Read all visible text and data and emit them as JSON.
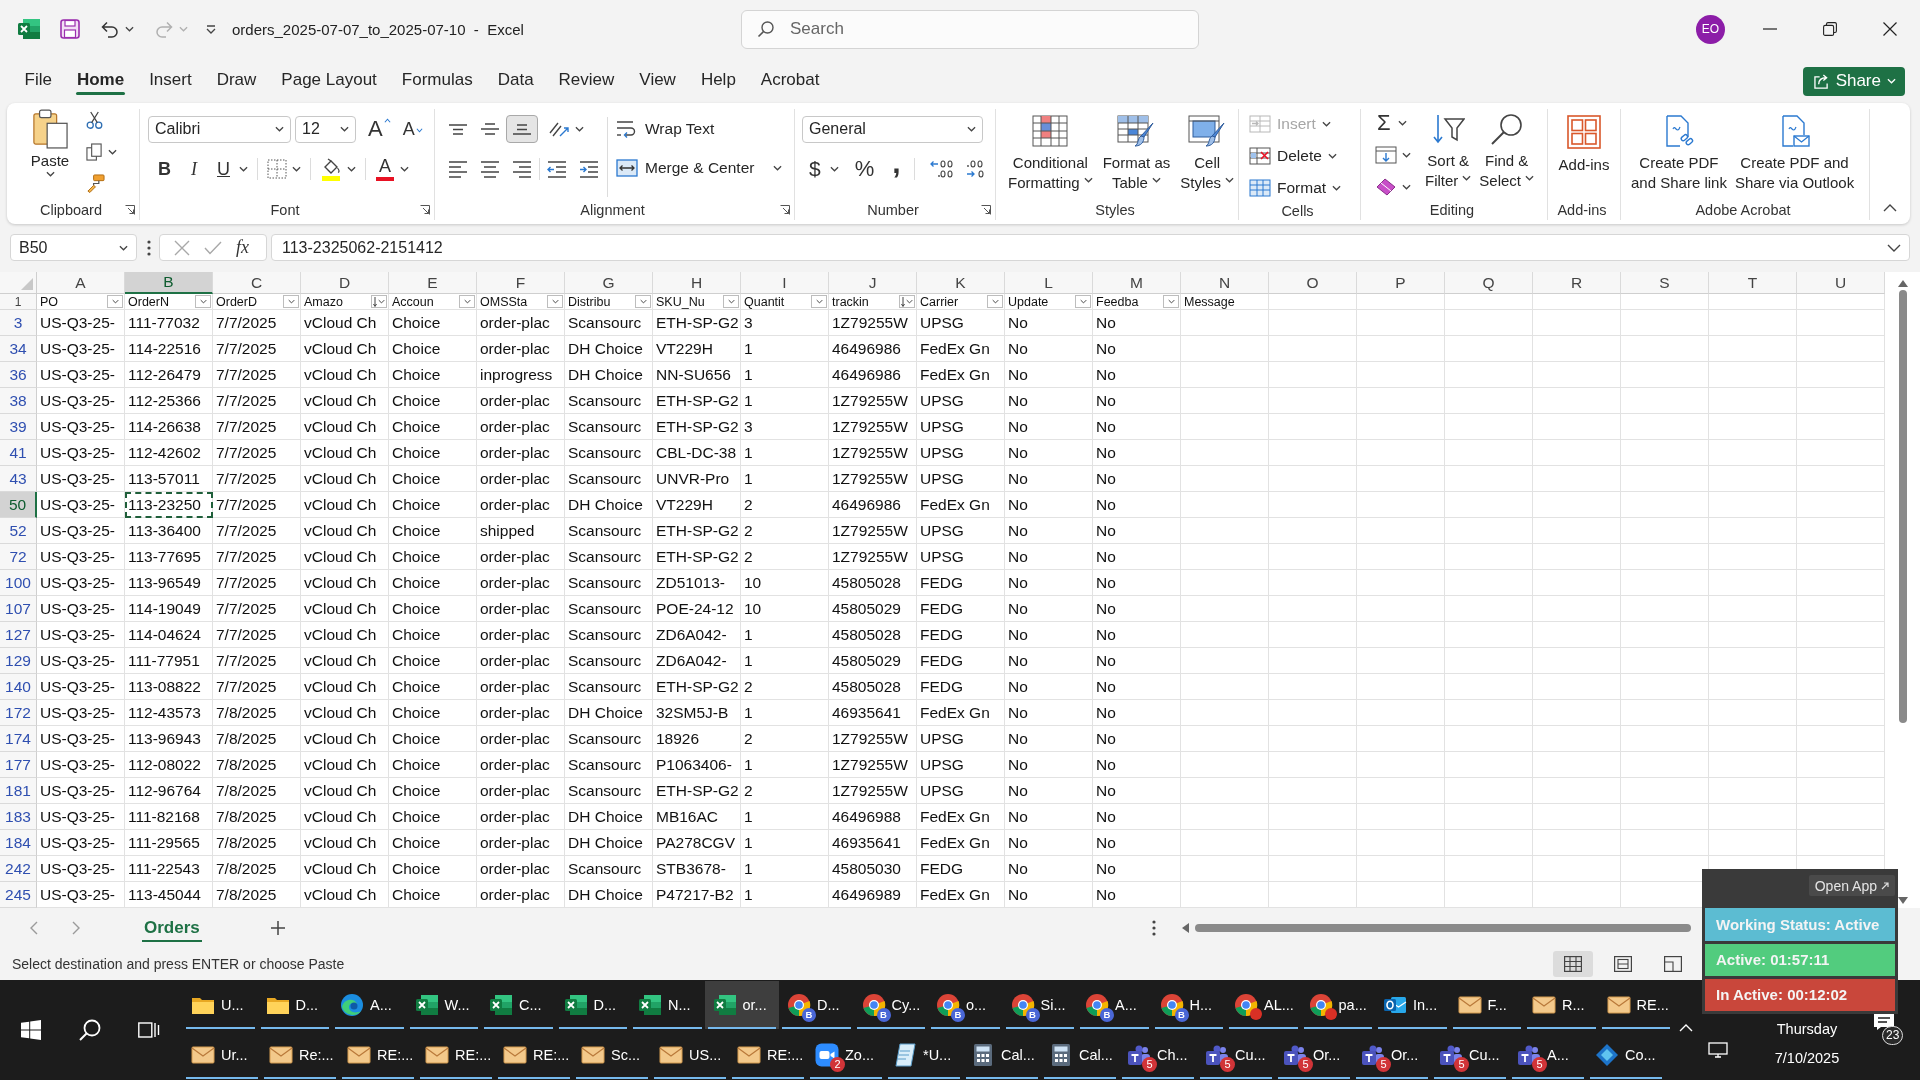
{
  "title_bar": {
    "title": "orders_2025-07-07_to_2025-07-10  -  Excel",
    "search": {
      "placeholder": "Search"
    },
    "account_initials": "EO"
  },
  "tabs": [
    {
      "label": "File",
      "selected": false
    },
    {
      "label": "Home",
      "selected": true
    },
    {
      "label": "Insert",
      "selected": false
    },
    {
      "label": "Draw",
      "selected": false
    },
    {
      "label": "Page Layout",
      "selected": false
    },
    {
      "label": "Formulas",
      "selected": false
    },
    {
      "label": "Data",
      "selected": false
    },
    {
      "label": "Review",
      "selected": false
    },
    {
      "label": "View",
      "selected": false
    },
    {
      "label": "Help",
      "selected": false
    },
    {
      "label": "Acrobat",
      "selected": false
    }
  ],
  "share_button": "Share",
  "ribbon": {
    "clipboard": {
      "label": "Clipboard",
      "paste": "Paste"
    },
    "font": {
      "label": "Font",
      "font_name": "Calibri",
      "font_size": "12",
      "grow": "A",
      "shrink": "A",
      "bold": "B",
      "italic": "I",
      "underline": "U",
      "font_color": "A"
    },
    "alignment": {
      "label": "Alignment",
      "vertical": [
        {
          "kind": "top",
          "selected": false
        },
        {
          "kind": "middle",
          "selected": false
        },
        {
          "kind": "bottom",
          "selected": true
        }
      ],
      "wrap_text": "Wrap Text",
      "merge": "Merge & Center"
    },
    "number": {
      "label": "Number",
      "format": "General",
      "currency": "$",
      "percent": "%",
      "comma": ","
    },
    "styles": {
      "label": "Styles",
      "buttons": [
        {
          "kind": "conditional",
          "lines": [
            "Conditional",
            "Formatting"
          ]
        },
        {
          "kind": "table",
          "lines": [
            "Format as",
            "Table"
          ]
        },
        {
          "kind": "cell",
          "lines": [
            "Cell",
            "Styles"
          ]
        }
      ]
    },
    "cells": {
      "label": "Cells",
      "buttons": [
        {
          "kind": "insert",
          "label": "Insert",
          "disabled": true
        },
        {
          "kind": "delete",
          "label": "Delete",
          "disabled": false
        },
        {
          "kind": "format",
          "label": "Format",
          "disabled": false
        }
      ]
    },
    "editing": {
      "label": "Editing",
      "autosum": "Σ",
      "buttons": [
        {
          "kind": "sort",
          "lines": [
            "Sort &",
            "Filter"
          ]
        },
        {
          "kind": "find",
          "lines": [
            "Find &",
            "Select"
          ]
        }
      ]
    },
    "addins": {
      "label": "Add-ins",
      "button": "Add-ins"
    },
    "acrobat": {
      "label": "Adobe Acrobat",
      "buttons": [
        {
          "kind": "link",
          "lines": [
            "Create PDF",
            "and Share link"
          ]
        },
        {
          "kind": "mail",
          "lines": [
            "Create PDF and",
            "Share via Outlook"
          ]
        }
      ]
    }
  },
  "formula_bar": {
    "name_box": "B50",
    "function_button": "fx",
    "value": "113-2325062-2151412"
  },
  "sheet": {
    "columns": [
      {
        "label": "A",
        "selected": false
      },
      {
        "label": "B",
        "selected": true
      },
      {
        "label": "C",
        "selected": false
      },
      {
        "label": "D",
        "selected": false
      },
      {
        "label": "E",
        "selected": false
      },
      {
        "label": "F",
        "selected": false
      },
      {
        "label": "G",
        "selected": false
      },
      {
        "label": "H",
        "selected": false
      },
      {
        "label": "I",
        "selected": false
      },
      {
        "label": "J",
        "selected": false
      },
      {
        "label": "K",
        "selected": false
      },
      {
        "label": "L",
        "selected": false
      },
      {
        "label": "M",
        "selected": false
      },
      {
        "label": "N",
        "selected": false
      },
      {
        "label": "O",
        "selected": false
      },
      {
        "label": "P",
        "selected": false
      },
      {
        "label": "Q",
        "selected": false
      },
      {
        "label": "R",
        "selected": false
      },
      {
        "label": "S",
        "selected": false
      },
      {
        "label": "T",
        "selected": false
      },
      {
        "label": "U",
        "selected": false
      }
    ],
    "header_row": {
      "number": "1",
      "cells": [
        {
          "text": "PO",
          "kind": "filter"
        },
        {
          "text": "OrderN",
          "kind": "filter"
        },
        {
          "text": "OrderD",
          "kind": "filter"
        },
        {
          "text": "Amazo",
          "kind": "sorted"
        },
        {
          "text": "Accoun",
          "kind": "filter"
        },
        {
          "text": "OMSSta",
          "kind": "filter"
        },
        {
          "text": "Distribu",
          "kind": "filter"
        },
        {
          "text": "SKU_Nu",
          "kind": "filter"
        },
        {
          "text": "Quantit",
          "kind": "filter"
        },
        {
          "text": "trackin",
          "kind": "sorted"
        },
        {
          "text": "Carrier",
          "kind": "filter"
        },
        {
          "text": "Update",
          "kind": "filter"
        },
        {
          "text": "Feedba",
          "kind": "filter"
        },
        {
          "text": "Message",
          "kind": "plain"
        }
      ]
    },
    "rows": [
      {
        "number": "3",
        "selected": false,
        "cells": [
          "US-Q3-25-",
          "111-77032",
          "7/7/2025",
          "vCloud Ch",
          "Choice",
          "order-plac",
          "Scansourc",
          "ETH-SP-G2",
          "3",
          "1Z79255W",
          "UPSG",
          "No",
          "No"
        ]
      },
      {
        "number": "34",
        "selected": false,
        "cells": [
          "US-Q3-25-",
          "114-22516",
          "7/7/2025",
          "vCloud Ch",
          "Choice",
          "order-plac",
          "DH Choice",
          "VT229H",
          "1",
          "46496986",
          "FedEx Gn",
          "No",
          "No"
        ]
      },
      {
        "number": "36",
        "selected": false,
        "cells": [
          "US-Q3-25-",
          "112-26479",
          "7/7/2025",
          "vCloud Ch",
          "Choice",
          "inprogress",
          "DH Choice",
          "NN-SU656",
          "1",
          "46496986",
          "FedEx Gn",
          "No",
          "No"
        ]
      },
      {
        "number": "38",
        "selected": false,
        "cells": [
          "US-Q3-25-",
          "112-25366",
          "7/7/2025",
          "vCloud Ch",
          "Choice",
          "order-plac",
          "Scansourc",
          "ETH-SP-G2",
          "1",
          "1Z79255W",
          "UPSG",
          "No",
          "No"
        ]
      },
      {
        "number": "39",
        "selected": false,
        "cells": [
          "US-Q3-25-",
          "114-26638",
          "7/7/2025",
          "vCloud Ch",
          "Choice",
          "order-plac",
          "Scansourc",
          "ETH-SP-G2",
          "3",
          "1Z79255W",
          "UPSG",
          "No",
          "No"
        ]
      },
      {
        "number": "41",
        "selected": false,
        "cells": [
          "US-Q3-25-",
          "112-42602",
          "7/7/2025",
          "vCloud Ch",
          "Choice",
          "order-plac",
          "Scansourc",
          "CBL-DC-38",
          "1",
          "1Z79255W",
          "UPSG",
          "No",
          "No"
        ]
      },
      {
        "number": "43",
        "selected": false,
        "cells": [
          "US-Q3-25-",
          "113-57011",
          "7/7/2025",
          "vCloud Ch",
          "Choice",
          "order-plac",
          "Scansourc",
          "UNVR-Pro",
          "1",
          "1Z79255W",
          "UPSG",
          "No",
          "No"
        ]
      },
      {
        "number": "50",
        "selected": true,
        "cells": [
          "US-Q3-25-",
          "113-23250",
          "7/7/2025",
          "vCloud Ch",
          "Choice",
          "order-plac",
          "DH Choice",
          "VT229H",
          "2",
          "46496986",
          "FedEx Gn",
          "No",
          "No"
        ]
      },
      {
        "number": "52",
        "selected": false,
        "cells": [
          "US-Q3-25-",
          "113-36400",
          "7/7/2025",
          "vCloud Ch",
          "Choice",
          "shipped",
          "Scansourc",
          "ETH-SP-G2",
          "2",
          "1Z79255W",
          "UPSG",
          "No",
          "No"
        ]
      },
      {
        "number": "72",
        "selected": false,
        "cells": [
          "US-Q3-25-",
          "113-77695",
          "7/7/2025",
          "vCloud Ch",
          "Choice",
          "order-plac",
          "Scansourc",
          "ETH-SP-G2",
          "2",
          "1Z79255W",
          "UPSG",
          "No",
          "No"
        ]
      },
      {
        "number": "100",
        "selected": false,
        "cells": [
          "US-Q3-25-",
          "113-96549",
          "7/7/2025",
          "vCloud Ch",
          "Choice",
          "order-plac",
          "Scansourc",
          "ZD51013-",
          "10",
          "45805028",
          "FEDG",
          "No",
          "No"
        ]
      },
      {
        "number": "107",
        "selected": false,
        "cells": [
          "US-Q3-25-",
          "114-19049",
          "7/7/2025",
          "vCloud Ch",
          "Choice",
          "order-plac",
          "Scansourc",
          "POE-24-12",
          "10",
          "45805029",
          "FEDG",
          "No",
          "No"
        ]
      },
      {
        "number": "127",
        "selected": false,
        "cells": [
          "US-Q3-25-",
          "114-04624",
          "7/7/2025",
          "vCloud Ch",
          "Choice",
          "order-plac",
          "Scansourc",
          "ZD6A042-",
          "1",
          "45805028",
          "FEDG",
          "No",
          "No"
        ]
      },
      {
        "number": "129",
        "selected": false,
        "cells": [
          "US-Q3-25-",
          "111-77951",
          "7/7/2025",
          "vCloud Ch",
          "Choice",
          "order-plac",
          "Scansourc",
          "ZD6A042-",
          "1",
          "45805029",
          "FEDG",
          "No",
          "No"
        ]
      },
      {
        "number": "140",
        "selected": false,
        "cells": [
          "US-Q3-25-",
          "113-08822",
          "7/7/2025",
          "vCloud Ch",
          "Choice",
          "order-plac",
          "Scansourc",
          "ETH-SP-G2",
          "2",
          "45805028",
          "FEDG",
          "No",
          "No"
        ]
      },
      {
        "number": "172",
        "selected": false,
        "cells": [
          "US-Q3-25-",
          "112-43573",
          "7/8/2025",
          "vCloud Ch",
          "Choice",
          "order-plac",
          "DH Choice",
          "32SM5J-B",
          "1",
          "46935641",
          "FedEx Gn",
          "No",
          "No"
        ]
      },
      {
        "number": "174",
        "selected": false,
        "cells": [
          "US-Q3-25-",
          "113-96943",
          "7/8/2025",
          "vCloud Ch",
          "Choice",
          "order-plac",
          "Scansourc",
          "18926",
          "2",
          "1Z79255W",
          "UPSG",
          "No",
          "No"
        ]
      },
      {
        "number": "177",
        "selected": false,
        "cells": [
          "US-Q3-25-",
          "112-08022",
          "7/8/2025",
          "vCloud Ch",
          "Choice",
          "order-plac",
          "Scansourc",
          "P1063406-",
          "1",
          "1Z79255W",
          "UPSG",
          "No",
          "No"
        ]
      },
      {
        "number": "181",
        "selected": false,
        "cells": [
          "US-Q3-25-",
          "112-96764",
          "7/8/2025",
          "vCloud Ch",
          "Choice",
          "order-plac",
          "Scansourc",
          "ETH-SP-G2",
          "2",
          "1Z79255W",
          "UPSG",
          "No",
          "No"
        ]
      },
      {
        "number": "183",
        "selected": false,
        "cells": [
          "US-Q3-25-",
          "111-82168",
          "7/8/2025",
          "vCloud Ch",
          "Choice",
          "order-plac",
          "DH Choice",
          "MB16AC",
          "1",
          "46496988",
          "FedEx Gn",
          "No",
          "No"
        ]
      },
      {
        "number": "184",
        "selected": false,
        "cells": [
          "US-Q3-25-",
          "111-29565",
          "7/8/2025",
          "vCloud Ch",
          "Choice",
          "order-plac",
          "DH Choice",
          "PA278CGV",
          "1",
          "46935641",
          "FedEx Gn",
          "No",
          "No"
        ]
      },
      {
        "number": "242",
        "selected": false,
        "cells": [
          "US-Q3-25-",
          "111-22543",
          "7/8/2025",
          "vCloud Ch",
          "Choice",
          "order-plac",
          "Scansourc",
          "STB3678-",
          "1",
          "45805030",
          "FEDG",
          "No",
          "No"
        ]
      },
      {
        "number": "245",
        "selected": false,
        "cells": [
          "US-Q3-25-",
          "113-45044",
          "7/8/2025",
          "vCloud Ch",
          "Choice",
          "order-plac",
          "DH Choice",
          "P47217-B2",
          "1",
          "46496989",
          "FedEx Gn",
          "No",
          "No"
        ]
      }
    ]
  },
  "sheet_tabs": [
    {
      "label": "Orders",
      "selected": true
    }
  ],
  "status_bar": {
    "message": "Select destination and press ENTER or choose Paste",
    "views": [
      {
        "kind": "normal",
        "selected": true
      },
      {
        "kind": "layout",
        "selected": false
      },
      {
        "kind": "pagebreak",
        "selected": false
      }
    ]
  },
  "tracker_widget": {
    "open_app": "Open App",
    "status": "Working Status: Active",
    "active_time": "Active: 01:57:11",
    "inactive_time": "In Active: 00:12:02"
  },
  "taskbar": {
    "row_1": [
      {
        "kind": "folder",
        "label": "U...",
        "selected": false
      },
      {
        "kind": "folder",
        "label": "D...",
        "selected": false
      },
      {
        "kind": "edge",
        "label": "A...",
        "selected": false
      },
      {
        "kind": "excel",
        "label": "W...",
        "selected": false
      },
      {
        "kind": "excel",
        "label": "C...",
        "selected": false
      },
      {
        "kind": "excel",
        "label": "D...",
        "selected": false
      },
      {
        "kind": "excel",
        "label": "N...",
        "selected": false
      },
      {
        "kind": "excel",
        "label": "or...",
        "selected": true
      },
      {
        "kind": "chrome",
        "label": "D...",
        "selected": false,
        "color": "#4a67d6",
        "profile": "B"
      },
      {
        "kind": "chrome",
        "label": "Cy...",
        "selected": false,
        "color": "#4a67d6",
        "profile": "B"
      },
      {
        "kind": "chrome",
        "label": "o...",
        "selected": false,
        "color": "#4a67d6",
        "profile": "B"
      },
      {
        "kind": "chrome",
        "label": "Si...",
        "selected": false,
        "color": "#4a67d6",
        "profile": "B"
      },
      {
        "kind": "chrome",
        "label": "A...",
        "selected": false,
        "color": "#4a67d6",
        "profile": "B"
      },
      {
        "kind": "chrome",
        "label": "H...",
        "selected": false,
        "color": "#4a67d6",
        "profile": "B"
      },
      {
        "kind": "chrome",
        "label": "AL...",
        "selected": false,
        "color": "#d93025"
      },
      {
        "kind": "chrome",
        "label": "pa...",
        "selected": false,
        "color": "#d93025"
      },
      {
        "kind": "outlook",
        "label": "In...",
        "selected": false
      },
      {
        "kind": "mail",
        "label": "F...",
        "selected": false
      },
      {
        "kind": "mail",
        "label": "R...",
        "selected": false
      },
      {
        "kind": "mail",
        "label": "RE...",
        "selected": false
      }
    ],
    "row_2": [
      {
        "kind": "mail",
        "label": "Ur...",
        "selected": false
      },
      {
        "kind": "mail",
        "label": "Re:...",
        "selected": false
      },
      {
        "kind": "mail",
        "label": "RE:...",
        "selected": false
      },
      {
        "kind": "mail",
        "label": "RE:...",
        "selected": false
      },
      {
        "kind": "mail",
        "label": "RE:...",
        "selected": false
      },
      {
        "kind": "mail",
        "label": "Sc...",
        "selected": false
      },
      {
        "kind": "mail",
        "label": "US...",
        "selected": false
      },
      {
        "kind": "mail",
        "label": "RE:...",
        "selected": false
      },
      {
        "kind": "zoom",
        "label": "Zo...",
        "selected": false,
        "badge": "2"
      },
      {
        "kind": "notepad",
        "label": "*U...",
        "selected": false
      },
      {
        "kind": "calculator",
        "label": "Cal...",
        "selected": false
      },
      {
        "kind": "calculator",
        "label": "Cal...",
        "selected": false
      },
      {
        "kind": "teams",
        "label": "Ch...",
        "selected": false,
        "badge": "5"
      },
      {
        "kind": "teams",
        "label": "Cu...",
        "selected": false,
        "badge": "5"
      },
      {
        "kind": "teams",
        "label": "Or...",
        "selected": false,
        "badge": "5"
      },
      {
        "kind": "teams",
        "label": "Or...",
        "selected": false,
        "badge": "5"
      },
      {
        "kind": "teams",
        "label": "Cu...",
        "selected": false,
        "badge": "5"
      },
      {
        "kind": "teams",
        "label": "A...",
        "selected": false,
        "badge": "5"
      },
      {
        "kind": "app",
        "label": "Co...",
        "selected": false
      }
    ],
    "day": "Thursday",
    "date": "7/10/2025",
    "notification_count": "23"
  }
}
